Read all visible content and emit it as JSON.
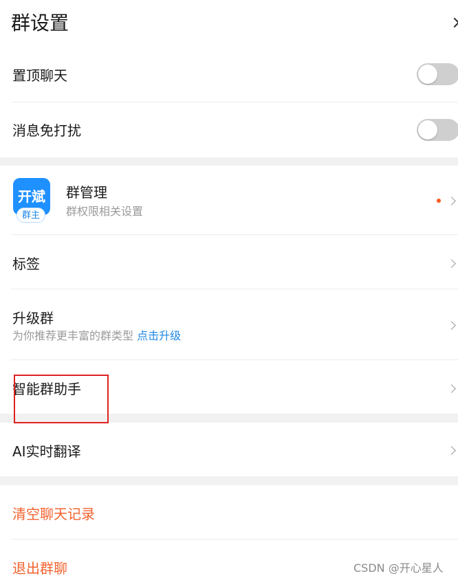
{
  "header": {
    "title": "群设置",
    "close_glyph": "×"
  },
  "settings": {
    "pin_chat": {
      "label": "置顶聊天",
      "on": false
    },
    "do_not_disturb": {
      "label": "消息免打扰",
      "on": false
    }
  },
  "group_manage": {
    "avatar_text": "开斌",
    "owner_badge": "群主",
    "title": "群管理",
    "subtitle": "群权限相关设置",
    "has_notification_dot": true
  },
  "tags": {
    "label": "标签"
  },
  "upgrade": {
    "label": "升级群",
    "hint": "为你推荐更丰富的群类型",
    "link": "点击升级"
  },
  "assistant": {
    "label": "智能群助手"
  },
  "translate": {
    "label": "AI实时翻译"
  },
  "actions": {
    "clear_history": "清空聊天记录",
    "exit_group": "退出群聊"
  },
  "watermark": "CSDN @开心星人",
  "colors": {
    "accent": "#1e88e5",
    "danger": "#f2622e",
    "toggle_off": "#cfcfcf",
    "highlight_box": "#e02020"
  }
}
